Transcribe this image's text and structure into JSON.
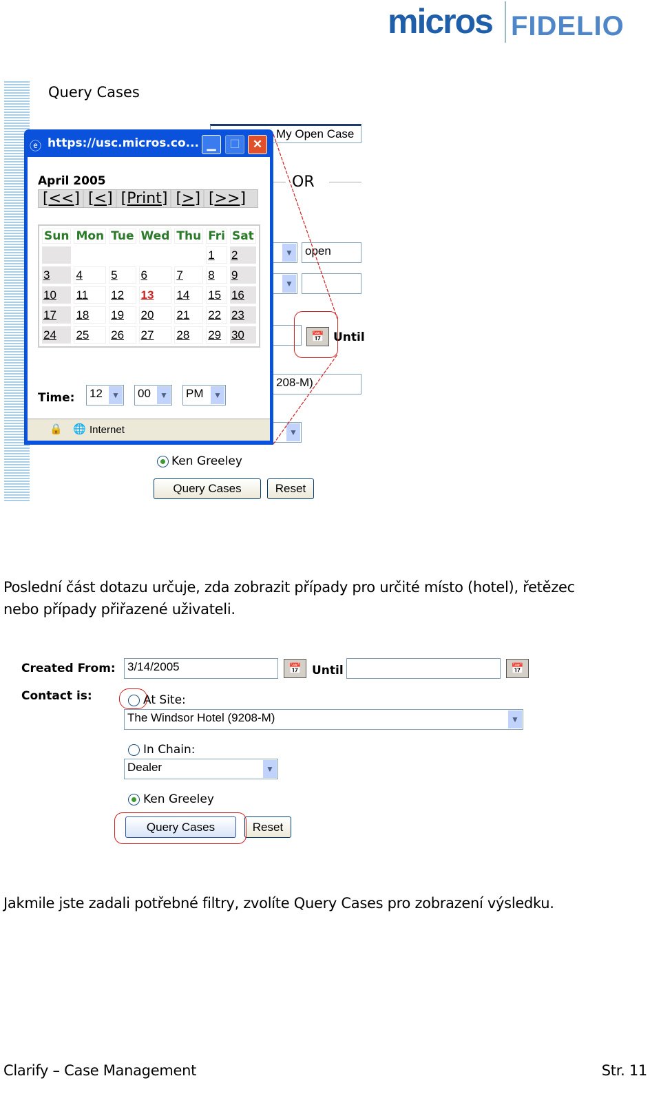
{
  "logo": {
    "brand1": "micros",
    "brand2": "FIDELIO"
  },
  "shot1": {
    "title": "Query Cases",
    "bg": {
      "my_open_case": "My Open Case",
      "or": "OR",
      "status_value": "open",
      "until": "Until",
      "site_fragment": "208-M)",
      "ken": "Ken Greeley",
      "query_button": "Query Cases",
      "reset_button": "Reset"
    },
    "popup": {
      "title": "https://usc.micros.co...",
      "month": "April 2005",
      "nav": [
        "[<<]",
        "[<]",
        "[Print]",
        "[>]",
        "[>>]"
      ],
      "days": [
        "Sun",
        "Mon",
        "Tue",
        "Wed",
        "Thu",
        "Fri",
        "Sat"
      ],
      "weeks": [
        [
          "",
          "",
          "",
          "",
          "",
          "1",
          "2"
        ],
        [
          "3",
          "4",
          "5",
          "6",
          "7",
          "8",
          "9"
        ],
        [
          "10",
          "11",
          "12",
          "13",
          "14",
          "15",
          "16"
        ],
        [
          "17",
          "18",
          "19",
          "20",
          "21",
          "22",
          "23"
        ],
        [
          "24",
          "25",
          "26",
          "27",
          "28",
          "29",
          "30"
        ]
      ],
      "today": "13",
      "today_color": "#cc1f1f",
      "time_label": "Time:",
      "hour": "12",
      "minute": "00",
      "ampm": "PM",
      "status": "Internet"
    }
  },
  "para1": [
    "Poslední část dotazu určuje, zda zobrazit případy pro určité místo (hotel), řetězec",
    "nebo případy přiřazené uživateli."
  ],
  "shot2": {
    "created_from_label": "Created From:",
    "created_from_value": "3/14/2005",
    "until_label": "Until",
    "until_value": "",
    "contact_label": "Contact is:",
    "at_site": "At Site:",
    "site_value": "The Windsor Hotel (9208-M)",
    "in_chain": "In Chain:",
    "chain_value": "Dealer",
    "ken": "Ken Greeley",
    "query_button": "Query Cases",
    "reset_button": "Reset"
  },
  "para2": "Jakmile jste zadali potřebné filtry, zvolíte Query Cases pro zobrazení výsledku.",
  "footer": {
    "left": "Clarify – Case Management",
    "right": "Str. 11"
  },
  "colors": {
    "accent_red": "#d02020",
    "window_blue": "#0a52dc",
    "day_header_green": "#2a7a2a"
  }
}
